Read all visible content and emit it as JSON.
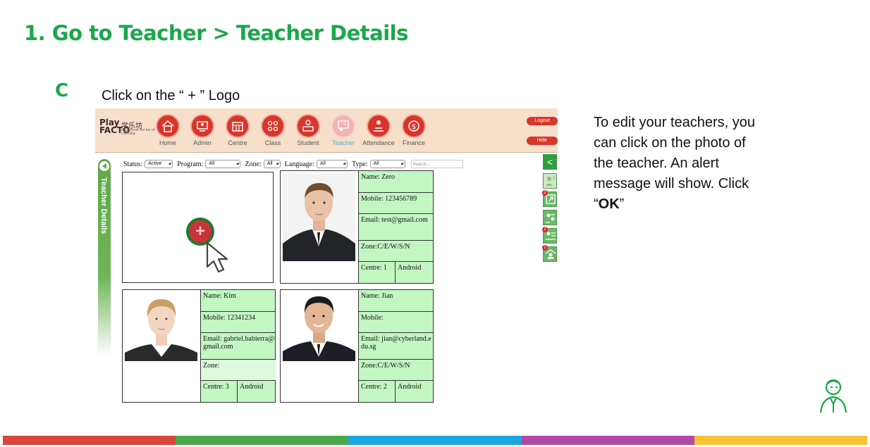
{
  "slide": {
    "title": "1. Go to Teacher > Teacher Details",
    "step_letter": "C",
    "step_text": "Click on the “ + ” Logo",
    "note_lines": [
      "To edit your teachers, you",
      "can click on the photo of",
      "the teacher. An alert",
      "message will show. Click"
    ],
    "note_ok": "OK",
    "bottom_colors": [
      "#d9473a",
      "#4ba84a",
      "#1aa6e0",
      "#b04aa8",
      "#f7c236"
    ]
  },
  "app": {
    "logo": {
      "play": "Play",
      "facto": "FACTO",
      "cn": "学乐坊",
      "tagline": "Rediscover the fun of Learning",
      "school": "SCHOOL"
    },
    "nav": [
      {
        "label": "Home",
        "icon": "home-icon",
        "active": false
      },
      {
        "label": "Admin",
        "icon": "admin-icon",
        "active": false
      },
      {
        "label": "Centre",
        "icon": "centre-icon",
        "active": false
      },
      {
        "label": "Class",
        "icon": "class-icon",
        "active": false
      },
      {
        "label": "Student",
        "icon": "student-icon",
        "active": false
      },
      {
        "label": "Teacher",
        "icon": "teacher-icon",
        "active": true
      },
      {
        "label": "Attendance",
        "icon": "attendance-icon",
        "active": false
      },
      {
        "label": "Finance",
        "icon": "finance-icon",
        "active": false
      }
    ],
    "logout_label": "Logout",
    "hide_label": "Hide",
    "side_tab_label": "Teacher Details",
    "filters": {
      "status_label": "Status:",
      "status_value": "Active",
      "program_label": "Program:",
      "program_value": "All",
      "zone_label": "Zone:",
      "zone_value": "All",
      "language_label": "Language:",
      "language_value": "All",
      "type_label": "Type:",
      "type_value": "All",
      "search_placeholder": "Search..."
    },
    "teachers": [
      {
        "name": "Name: Zero",
        "mobile": "Mobile: 123456789",
        "email": "Email: test@gmail.com",
        "zone": "Zone:C/E/W/S/N",
        "centre": "Centre: 1",
        "device": "Android"
      },
      {
        "name": "Name: Kim",
        "mobile": "Mobile: 12341234",
        "email": "Email: gabriel.babierra@gmail.com",
        "zone": "Zone:",
        "centre": "Centre: 3",
        "device": "Android"
      },
      {
        "name": "Name: Jian",
        "mobile": "Mobile:",
        "email": "Email: jian@cyberland.edu.sg",
        "zone": "Zone:C/E/W/S/N",
        "centre": "Centre: 2",
        "device": "Android"
      }
    ],
    "add_symbol": "+",
    "right_toolbar": [
      {
        "icon": "back-chevron-icon",
        "glyph": "<"
      },
      {
        "icon": "help-user-icon",
        "badge": ""
      },
      {
        "icon": "assign-icon",
        "badge": "2"
      },
      {
        "icon": "group-icon",
        "badge": ""
      },
      {
        "icon": "report-icon",
        "badge": "2"
      },
      {
        "icon": "classroom-icon",
        "badge": "1"
      }
    ]
  }
}
